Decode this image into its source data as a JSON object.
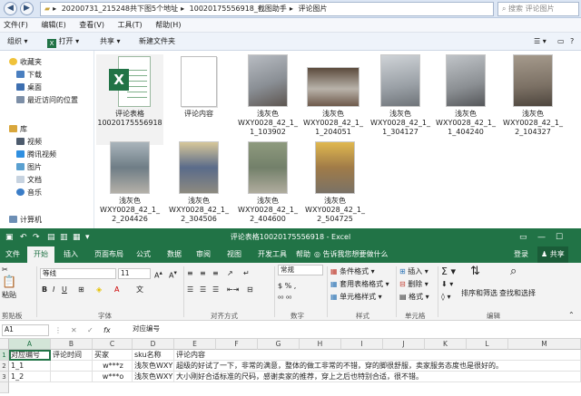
{
  "explorer": {
    "breadcrumb": [
      "20200731_215248共下图5个地址",
      "10020175556918_截图助手",
      "评论图片"
    ],
    "search_placeholder": "搜索 评论图片",
    "menu": [
      "文件(F)",
      "编辑(E)",
      "查看(V)",
      "工具(T)",
      "帮助(H)"
    ],
    "toolbar": {
      "organize": "组织 ▾",
      "open": "打开 ▾",
      "share": "共享 ▾",
      "new_folder": "新建文件夹"
    },
    "nav": {
      "favorites": "收藏夹",
      "fav_items": [
        "下载",
        "桌面",
        "最近访问的位置"
      ],
      "library": "库",
      "lib_items": [
        "视频",
        "腾讯视频",
        "图片",
        "文档",
        "音乐"
      ],
      "computer": "计算机"
    },
    "files": [
      {
        "label": "评论表格\n10020175556918",
        "kind": "xlsx"
      },
      {
        "label": "评论内容",
        "kind": "doc"
      },
      {
        "label": "浅灰色\nWXY0028_42_1_\n1_103902",
        "kind": "photo",
        "tone": "#8a8f95"
      },
      {
        "label": "浅灰色\nWXY0028_42_1_\n1_204051",
        "kind": "photo",
        "tone": "#6e5a4c"
      },
      {
        "label": "浅灰色\nWXY0028_42_1_\n1_304127",
        "kind": "photo",
        "tone": "#9aa0a6"
      },
      {
        "label": "浅灰色\nWXY0028_42_1_\n1_404240",
        "kind": "photo",
        "tone": "#8b8f93"
      },
      {
        "label": "浅灰色\nWXY0028_42_1_\n2_104327",
        "kind": "photo",
        "tone": "#7c7165"
      },
      {
        "label": "浅灰色\nWXY0028_42_1_\n2_204426",
        "kind": "photo",
        "tone": "#6f7d86"
      },
      {
        "label": "浅灰色\nWXY0028_42_1_\n2_304506",
        "kind": "photo",
        "tone": "#5a6b8a"
      },
      {
        "label": "浅灰色\nWXY0028_42_1_\n2_404600",
        "kind": "photo",
        "tone": "#73806a"
      },
      {
        "label": "浅灰色\nWXY0028_42_1_\n2_504725",
        "kind": "photo",
        "tone": "#a07b48"
      }
    ]
  },
  "excel": {
    "title": "评论表格10020175556918 - Excel",
    "tabs": [
      "文件",
      "开始",
      "插入",
      "页面布局",
      "公式",
      "数据",
      "审阅",
      "视图",
      "开发工具",
      "帮助"
    ],
    "tell_me": "告诉我您想要做什么",
    "login": "登录",
    "share": "共享",
    "ribbon": {
      "paste": "粘贴",
      "clipboard": "剪贴板",
      "font_name": "等线",
      "font_size": "11",
      "font_group": "字体",
      "align_group": "对齐方式",
      "number_format": "常规",
      "number_group": "数字",
      "cond_format": "条件格式",
      "table_format": "套用表格格式",
      "cell_style": "单元格样式",
      "style_group": "样式",
      "insert": "插入",
      "delete": "删除",
      "format": "格式",
      "cells_group": "单元格",
      "sort_filter": "排序和筛选",
      "find_select": "查找和选择",
      "edit_group": "编辑"
    },
    "name_box": "A1",
    "fx": "fx",
    "formula": "对应编号",
    "columns": [
      "A",
      "B",
      "C",
      "D",
      "E",
      "F",
      "G",
      "H",
      "I",
      "J",
      "K",
      "L",
      "M"
    ],
    "rows": [
      {
        "num": "1",
        "cells": [
          "对应编号",
          "评论时间",
          "买家",
          "sku名称",
          "评论内容"
        ]
      },
      {
        "num": "2",
        "cells": [
          "1_1",
          "",
          "w***z",
          "浅灰色WXY",
          "超级的好试了一下，非常的满意，整体的做工非常的不错，穿的脚很舒服，卖家服务态度也是很好的。"
        ]
      },
      {
        "num": "3",
        "cells": [
          "1_2",
          "",
          "w***o",
          "浅灰色WXY",
          "大小刚好合适标准的尺码，感谢卖家的推荐，穿上之后也特别合适，很不错。"
        ]
      }
    ],
    "colors": {
      "excel_green": "#217346"
    }
  }
}
